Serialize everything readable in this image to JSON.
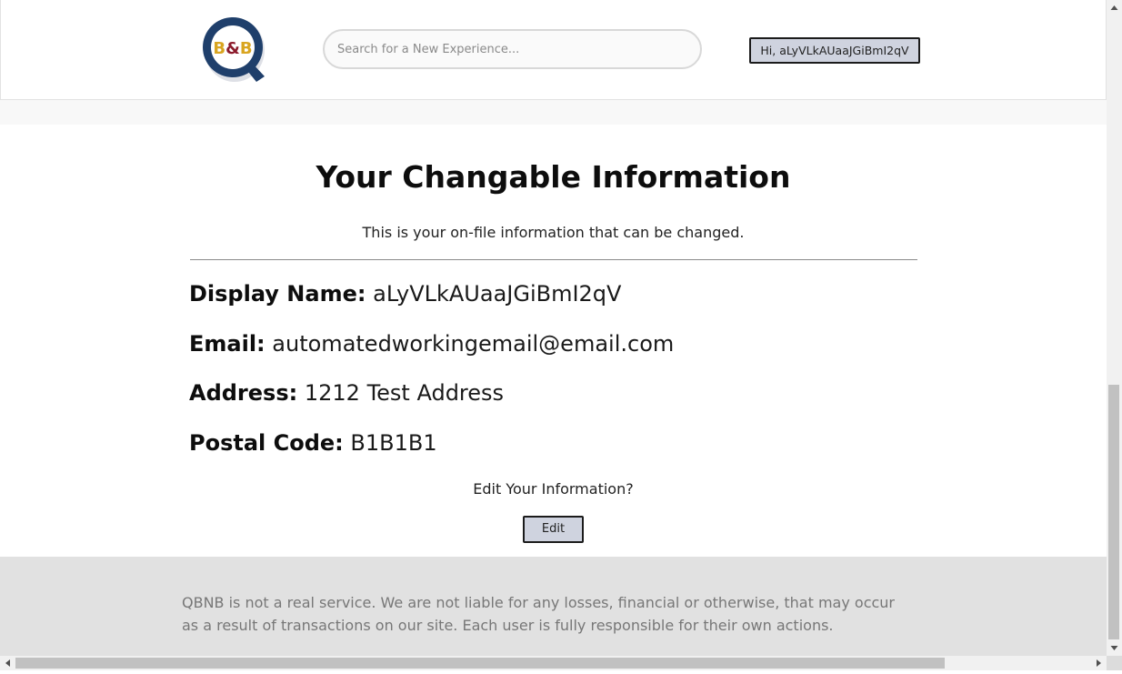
{
  "header": {
    "logo_text": "B&B",
    "search": {
      "placeholder": "Search for a New Experience...",
      "value": ""
    },
    "user_button_label": "Hi, aLyVLkAUaaJGiBmI2qV"
  },
  "main": {
    "title": "Your Changable Information",
    "subtitle": "This is your on-file information that can be changed.",
    "fields": [
      {
        "label": "Display Name:",
        "value": "aLyVLkAUaaJGiBmI2qV"
      },
      {
        "label": "Email:",
        "value": "automatedworkingemail@email.com"
      },
      {
        "label": "Address:",
        "value": "1212 Test Address"
      },
      {
        "label": "Postal Code:",
        "value": "B1B1B1"
      }
    ],
    "edit_prompt": "Edit Your Information?",
    "edit_button_label": "Edit"
  },
  "footer": {
    "disclaimer": "QBNB is not a real service. We are not liable for any losses, financial or otherwise, that may occur as a result of transactions on our site. Each user is fully responsible for their own actions."
  },
  "colors": {
    "logo_blue": "#1f3f6b",
    "logo_gold": "#d9a520",
    "logo_red": "#8b1a2b",
    "button_bg": "#cfd3df",
    "footer_bg": "#e1e1e1",
    "footer_text": "#777777"
  }
}
